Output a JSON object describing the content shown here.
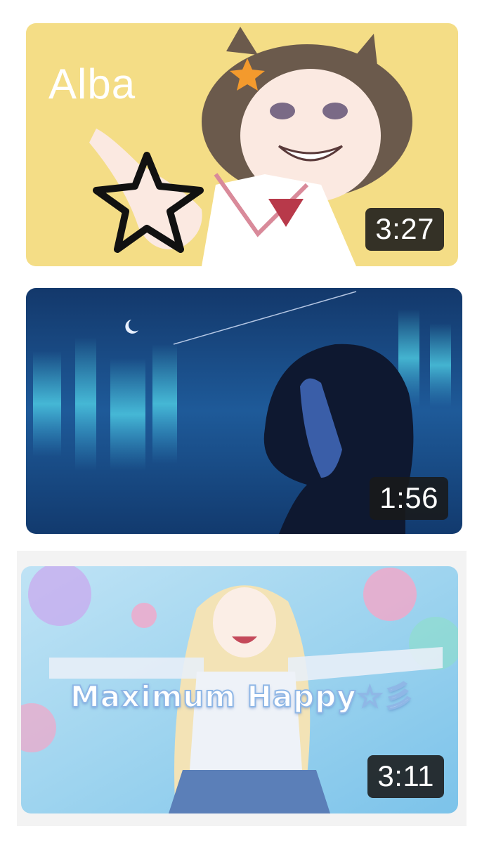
{
  "videos": [
    {
      "overlay_title": "Alba",
      "duration": "3:27",
      "accent_color": "#f4dd86"
    },
    {
      "duration": "1:56",
      "accent_color": "#1b4d8f"
    },
    {
      "banner_title": "Maximum Happy☆彡",
      "duration": "3:11",
      "accent_color": "#9ed4ef"
    }
  ]
}
